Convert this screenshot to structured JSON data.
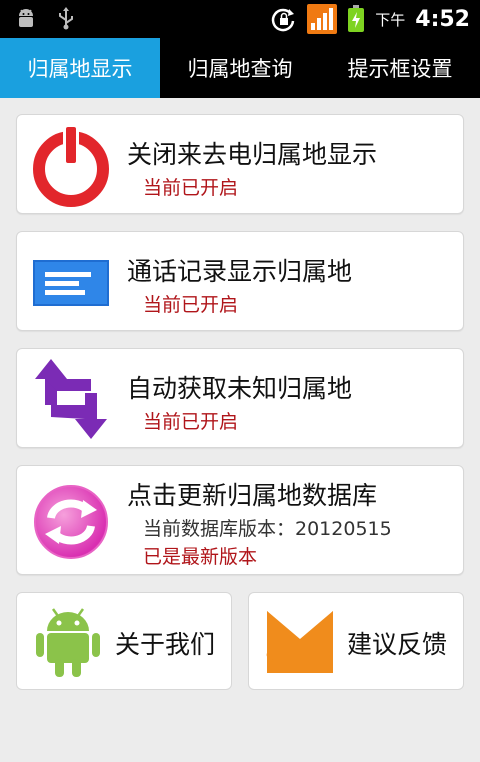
{
  "statusbar": {
    "time_period": "下午",
    "time": "4:52",
    "icons": [
      "android-debug-icon",
      "usb-icon",
      "rotation-lock-icon",
      "signal-icon",
      "battery-charging-icon"
    ]
  },
  "tabs": [
    {
      "label": "归属地显示",
      "active": true
    },
    {
      "label": "归属地查询",
      "active": false
    },
    {
      "label": "提示框设置",
      "active": false
    }
  ],
  "items": [
    {
      "title": "关闭来去电归属地显示",
      "status": "当前已开启",
      "icon": "power-icon"
    },
    {
      "title": "通话记录显示归属地",
      "status": "当前已开启",
      "icon": "call-log-icon"
    },
    {
      "title": "自动获取未知归属地",
      "status": "当前已开启",
      "icon": "sync-arrows-icon"
    },
    {
      "title": "点击更新归属地数据库",
      "version": "当前数据库版本：20120515",
      "status": "已是最新版本",
      "icon": "refresh-icon"
    }
  ],
  "about": {
    "label": "关于我们",
    "icon": "android-icon"
  },
  "feedback": {
    "label": "建议反馈",
    "icon": "envelope-icon"
  },
  "colors": {
    "accent": "#1aa0df",
    "status_red": "#b0151a"
  }
}
